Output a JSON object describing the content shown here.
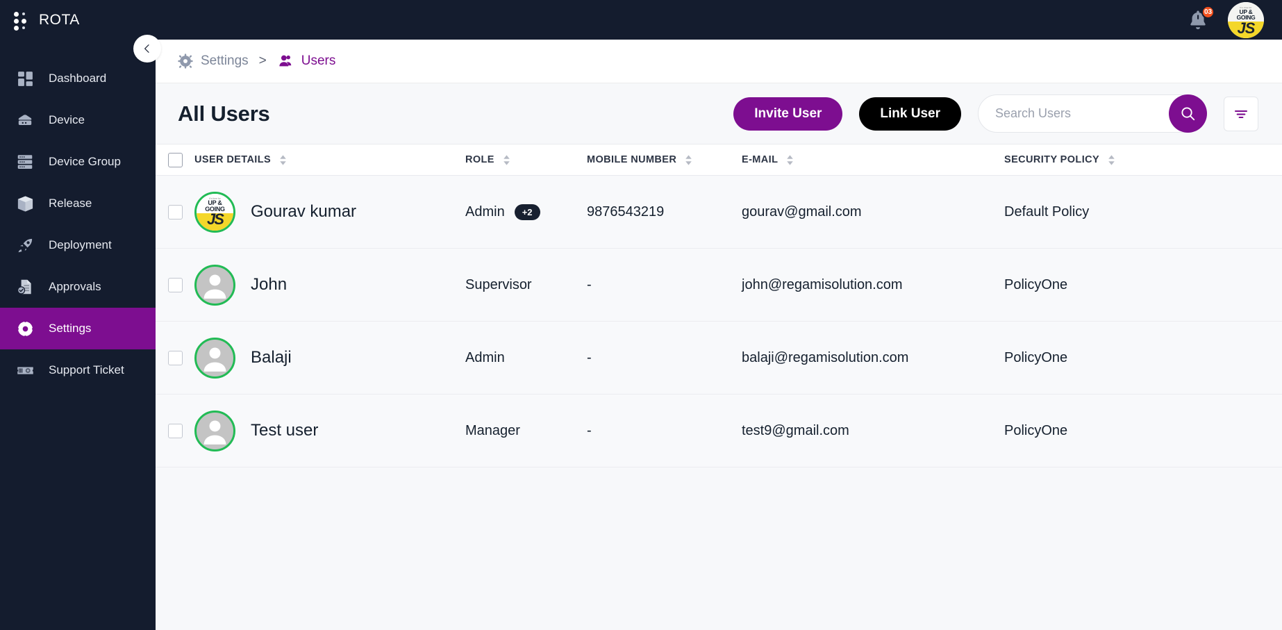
{
  "app": {
    "brand_name": "ROTA",
    "accent_color": "#7d0e90",
    "dark_color": "#141c2e",
    "ring_color": "#22bb55"
  },
  "topbar": {
    "notification_count": "03",
    "avatar": {
      "tiny_text": "It's time for",
      "title_line1": "UP &",
      "title_line2": "GOING",
      "initials": "JS"
    }
  },
  "sidebar": {
    "items": [
      {
        "label": "Dashboard",
        "icon": "dashboard-icon",
        "active": false
      },
      {
        "label": "Device",
        "icon": "device-icon",
        "active": false
      },
      {
        "label": "Device Group",
        "icon": "device-group-icon",
        "active": false
      },
      {
        "label": "Release",
        "icon": "release-box-icon",
        "active": false
      },
      {
        "label": "Deployment",
        "icon": "rocket-icon",
        "active": false
      },
      {
        "label": "Approvals",
        "icon": "approvals-icon",
        "active": false
      },
      {
        "label": "Settings",
        "icon": "gear-icon",
        "active": true
      },
      {
        "label": "Support Ticket",
        "icon": "ticket-icon",
        "active": false
      }
    ],
    "collapse_label": "collapse-sidebar"
  },
  "breadcrumb": {
    "parent": "Settings",
    "separator": ">",
    "current": "Users"
  },
  "toolbar": {
    "title": "All Users",
    "invite_label": "Invite User",
    "link_label": "Link User",
    "search_placeholder": "Search Users",
    "search_value": "",
    "filter_label": "filter"
  },
  "table": {
    "columns": [
      {
        "label": "USER DETAILS",
        "sortable": true
      },
      {
        "label": "ROLE",
        "sortable": true
      },
      {
        "label": "MOBILE NUMBER",
        "sortable": true
      },
      {
        "label": "E-MAIL",
        "sortable": true
      },
      {
        "label": "SECURITY POLICY",
        "sortable": true
      }
    ],
    "rows": [
      {
        "name": "Gourav kumar",
        "avatar_type": "brand",
        "role": "Admin",
        "role_extra": "+2",
        "mobile": "9876543219",
        "email": "gourav@gmail.com",
        "policy": "Default Policy",
        "checked": false
      },
      {
        "name": "John",
        "avatar_type": "person",
        "role": "Supervisor",
        "role_extra": "",
        "mobile": "-",
        "email": "john@regamisolution.com",
        "policy": "PolicyOne",
        "checked": false
      },
      {
        "name": "Balaji",
        "avatar_type": "person",
        "role": "Admin",
        "role_extra": "",
        "mobile": "-",
        "email": "balaji@regamisolution.com",
        "policy": "PolicyOne",
        "checked": false
      },
      {
        "name": "Test user",
        "avatar_type": "person",
        "role": "Manager",
        "role_extra": "",
        "mobile": "-",
        "email": "test9@gmail.com",
        "policy": "PolicyOne",
        "checked": false
      }
    ]
  }
}
